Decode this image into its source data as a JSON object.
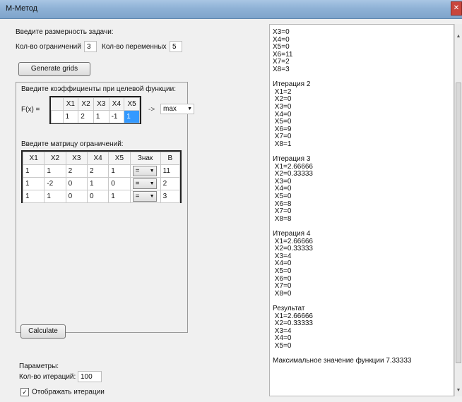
{
  "window": {
    "title": "M-Метод"
  },
  "left": {
    "dim_heading": "Введите размерность задачи:",
    "constraints_label": "Кол-во ограничений",
    "constraints_value": "3",
    "variables_label": "Кол-во переменных",
    "variables_value": "5",
    "generate_button": "Generate grids",
    "objective_heading": "Введите коэффициенты при целевой функции:",
    "fx_label": "F(x) =",
    "objective_headers": [
      "X1",
      "X2",
      "X3",
      "X4",
      "X5"
    ],
    "objective_values": [
      "1",
      "2",
      "1",
      "-1",
      "1"
    ],
    "arrow": "->",
    "direction": "max",
    "matrix_heading": "Введите матрицу ограничений:",
    "matrix_headers": [
      "X1",
      "X2",
      "X3",
      "X4",
      "X5",
      "Знак",
      "B"
    ],
    "matrix_rows": [
      [
        "1",
        "1",
        "2",
        "2",
        "1",
        "=",
        "11"
      ],
      [
        "1",
        "-2",
        "0",
        "1",
        "0",
        "=",
        "2"
      ],
      [
        "1",
        "1",
        "0",
        "0",
        "1",
        "=",
        "3"
      ]
    ],
    "calculate_button": "Calculate",
    "params_heading": "Параметры:",
    "iterations_label": "Кол-во итераций:",
    "iterations_value": "100",
    "show_iterations_label": "Отображать итерации",
    "show_iterations_checked": true
  },
  "log": {
    "lines": [
      "X3=0",
      "X4=0",
      "X5=0",
      "X6=11",
      "X7=2",
      "X8=3",
      "",
      "Итерация 2",
      " X1=2",
      " X2=0",
      " X3=0",
      " X4=0",
      " X5=0",
      " X6=9",
      " X7=0",
      " X8=1",
      "",
      "Итерация 3",
      " X1=2.66666",
      " X2=0.33333",
      " X3=0",
      " X4=0",
      " X5=0",
      " X6=8",
      " X7=0",
      " X8=8",
      "",
      "Итерация 4",
      " X1=2.66666",
      " X2=0.33333",
      " X3=4",
      " X4=0",
      " X5=0",
      " X6=0",
      " X7=0",
      " X8=0",
      "",
      "Результат",
      " X1=2.66666",
      " X2=0.33333",
      " X3=4",
      " X4=0",
      " X5=0",
      "",
      "Максимальное значение функции 7.33333"
    ]
  },
  "colors": {
    "selection": "#3399ff",
    "titlebar": "#8fb2d6"
  }
}
